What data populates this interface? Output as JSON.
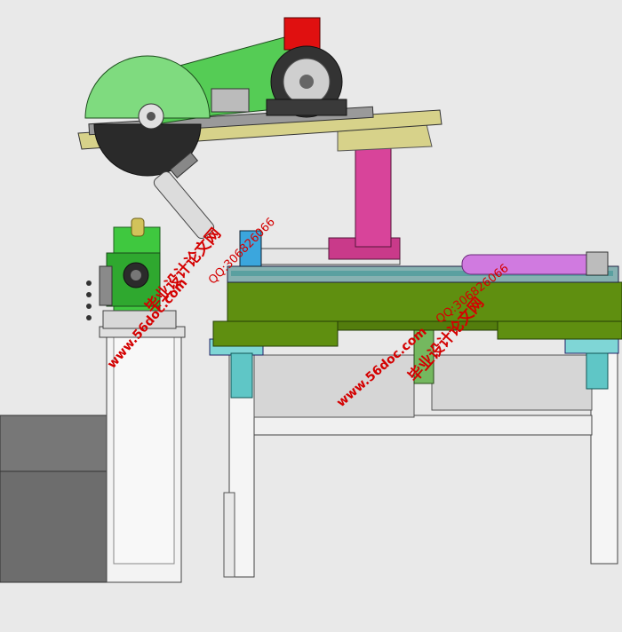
{
  "watermarks": {
    "site_name": "毕业设计论文网",
    "url": "www.56doc.com",
    "qq": "QQ:306826066"
  },
  "colors": {
    "background": "#e9e9e9",
    "saw_blade_upper": "#7fdb7f",
    "saw_blade_lower": "#2a2a2a",
    "saw_arm": "#55cc55",
    "motor_cap": "#e01010",
    "table_plate": "#d7d28a",
    "pink_support": "#d8449a",
    "machine_body": "#5f8f10",
    "rail": "#33cccc",
    "cylinder": "#d07ae0",
    "frame": "#f2f2f2",
    "dark_block": "#707070",
    "watermark": "#d40000"
  }
}
